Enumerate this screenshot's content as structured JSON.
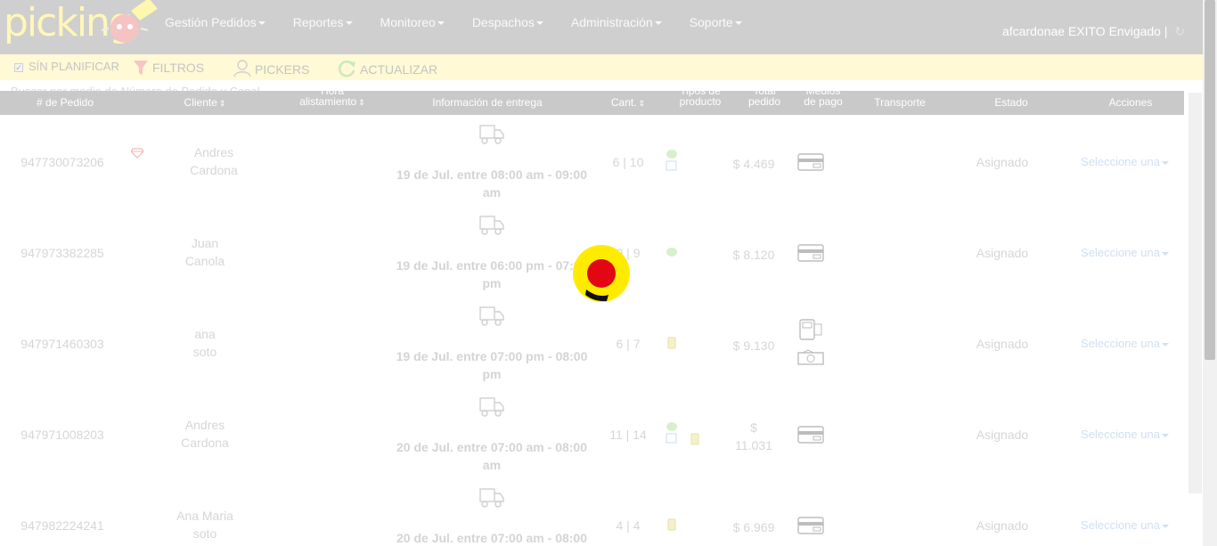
{
  "app": {
    "logo_text": "picking",
    "user_label": "afcardonae EXITO Envigado |"
  },
  "nav": {
    "items": [
      "Gestión Pedidos",
      "Reportes",
      "Monitoreo",
      "Despachos",
      "Administración",
      "Soporte"
    ]
  },
  "toolbar": {
    "sin_planificar": "SÍN PLANIFICAR",
    "filtros": "FILTROS",
    "pickers": "PICKERS",
    "actualizar": "ACTUALIZAR"
  },
  "search": {
    "text": "Buscar por medio de Número de Pedido y Canal"
  },
  "table": {
    "headers": {
      "order": "# de Pedido",
      "client": "Cliente",
      "hora_line1": "Hora",
      "hora_line2": "alistamiento",
      "info": "Información de entrega",
      "cant": "Cant.",
      "tipos_line1": "Tipos de",
      "tipos_line2": "producto",
      "total_line1": "Total",
      "total_line2": "pedido",
      "medios_line1": "Medios",
      "medios_line2": "de pago",
      "transporte": "Transporte",
      "estado": "Estado",
      "acciones": "Acciones"
    },
    "rows": [
      {
        "order": "947730073206",
        "client_first": "Andres",
        "client_last": "Cardona",
        "delivery": "19 de Jul. entre 08:00 am - 09:00 am",
        "qty": "6 | 10",
        "total": "$ 4.469",
        "estado": "Asignado",
        "accion": "Seleccione una"
      },
      {
        "order": "947973382285",
        "client_first": "Juan",
        "client_last": "Canola",
        "delivery": "19 de Jul. entre 06:00 pm - 07:00 pm",
        "qty": "9 | 9",
        "total": "$ 8.120",
        "estado": "Asignado",
        "accion": "Seleccione una"
      },
      {
        "order": "947971460303",
        "client_first": "ana",
        "client_last": "soto",
        "delivery": "19 de Jul. entre 07:00 pm - 08:00 pm",
        "qty": "6 | 7",
        "total": "$ 9.130",
        "estado": "Asignado",
        "accion": "Seleccione una"
      },
      {
        "order": "947971008203",
        "client_first": "Andres",
        "client_last": "Cardona",
        "delivery": "20 de Jul. entre 07:00 am - 08:00 am",
        "qty": "11 | 14",
        "total_line1": "$",
        "total_line2": "11.031",
        "estado": "Asignado",
        "accion": "Seleccione una"
      },
      {
        "order": "947982224241",
        "client_first": "Ana Maria",
        "client_last": "soto",
        "delivery": "20 de Jul. entre 07:00 am - 08:00",
        "qty": "4 | 4",
        "total": "$ 6.969",
        "estado": "Asignado",
        "accion": "Seleccione una"
      }
    ]
  },
  "colors": {
    "navbar": "#cfcfcf",
    "toolbar": "#fff9d6",
    "table_header": "#c9c9c9",
    "link": "#cfe0f1",
    "cursor_outer": "#ffeb00",
    "cursor_inner": "#e30613"
  }
}
